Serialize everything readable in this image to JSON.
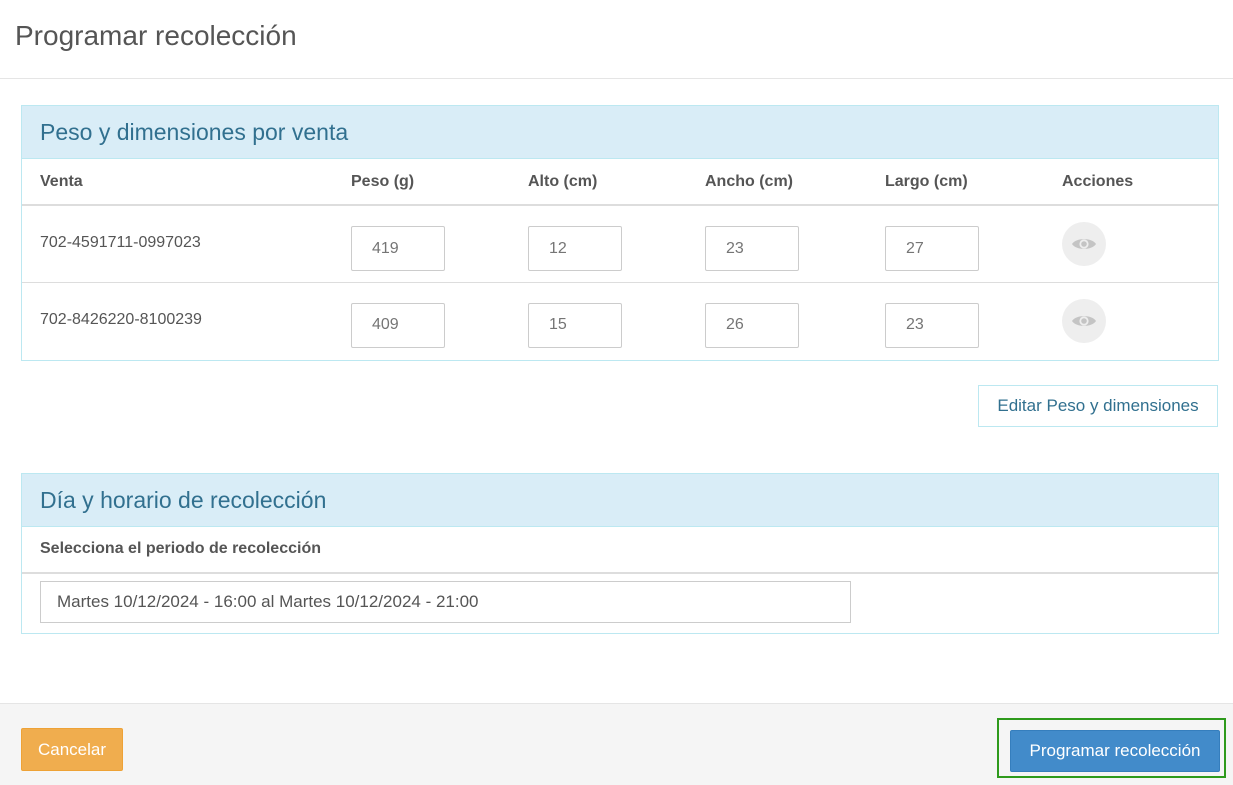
{
  "modal": {
    "title": "Programar recolección"
  },
  "dimensions_panel": {
    "title": "Peso y dimensiones por venta",
    "columns": [
      "Venta",
      "Peso (g)",
      "Alto (cm)",
      "Ancho (cm)",
      "Largo (cm)",
      "Acciones"
    ],
    "rows": [
      {
        "sale_id": "702-4591711-0997023",
        "peso": "419",
        "alto": "12",
        "ancho": "23",
        "largo": "27",
        "action_icon": "eye-icon"
      },
      {
        "sale_id": "702-8426220-8100239",
        "peso": "409",
        "alto": "15",
        "ancho": "26",
        "largo": "23",
        "action_icon": "eye-icon"
      }
    ],
    "edit_button": "Editar Peso y dimensiones"
  },
  "schedule_panel": {
    "title": "Día y horario de recolección",
    "label": "Selecciona el periodo de recolección",
    "selected_period": "Martes 10/12/2024 - 16:00 al Martes 10/12/2024 - 21:00"
  },
  "footer": {
    "cancel_label": "Cancelar",
    "submit_label": "Programar recolección"
  },
  "colors": {
    "panel_heading_bg": "#d9edf7",
    "panel_heading_text": "#31708f",
    "cancel_button": "#f0ad4e",
    "primary_button": "#428bca",
    "highlight_border": "#2e9a1c"
  }
}
